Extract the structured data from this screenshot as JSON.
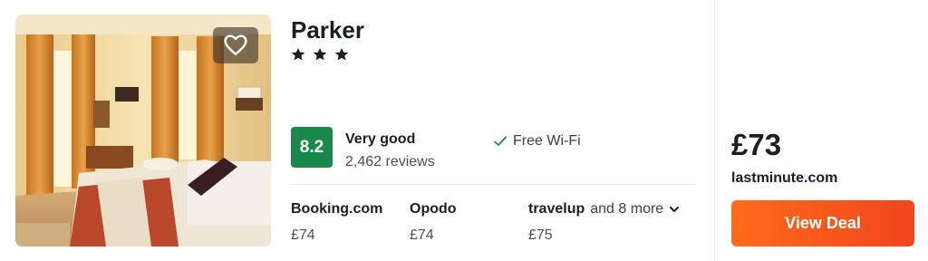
{
  "hotel": {
    "name": "Parker",
    "star_count": 3,
    "photo_alt": "hotel-room-photo"
  },
  "rating": {
    "score": "8.2",
    "label": "Very good",
    "reviews": "2,462 reviews",
    "color": "#1a8a4c"
  },
  "amenities": [
    {
      "label": "Free Wi-Fi",
      "icon": "check-icon"
    }
  ],
  "providers": [
    {
      "name": "Booking.com",
      "price": "£74"
    },
    {
      "name": "Opodo",
      "price": "£74"
    },
    {
      "name": "travelup",
      "price": "£75",
      "more": "and 8 more"
    }
  ],
  "deal": {
    "price": "£73",
    "provider": "lastminute.com",
    "button_label": "View Deal",
    "button_color": "#f25a1c"
  }
}
